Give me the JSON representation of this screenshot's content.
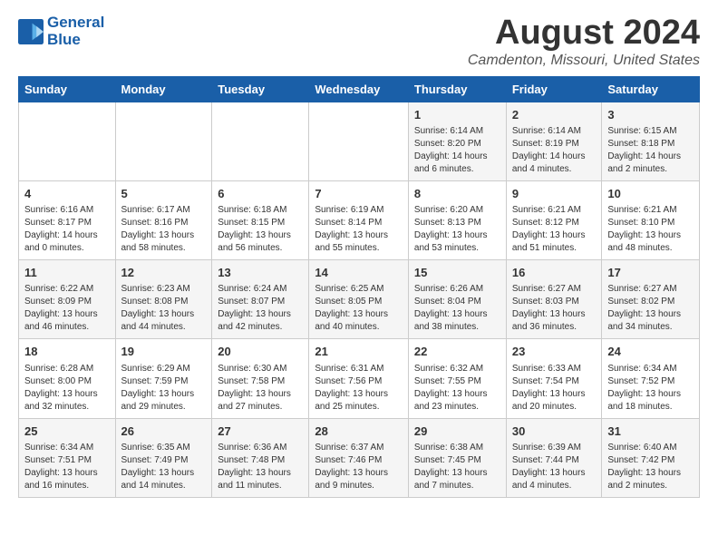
{
  "logo": {
    "line1": "General",
    "line2": "Blue"
  },
  "title": "August 2024",
  "subtitle": "Camdenton, Missouri, United States",
  "days_of_week": [
    "Sunday",
    "Monday",
    "Tuesday",
    "Wednesday",
    "Thursday",
    "Friday",
    "Saturday"
  ],
  "weeks": [
    [
      {
        "num": "",
        "info": ""
      },
      {
        "num": "",
        "info": ""
      },
      {
        "num": "",
        "info": ""
      },
      {
        "num": "",
        "info": ""
      },
      {
        "num": "1",
        "info": "Sunrise: 6:14 AM\nSunset: 8:20 PM\nDaylight: 14 hours\nand 6 minutes."
      },
      {
        "num": "2",
        "info": "Sunrise: 6:14 AM\nSunset: 8:19 PM\nDaylight: 14 hours\nand 4 minutes."
      },
      {
        "num": "3",
        "info": "Sunrise: 6:15 AM\nSunset: 8:18 PM\nDaylight: 14 hours\nand 2 minutes."
      }
    ],
    [
      {
        "num": "4",
        "info": "Sunrise: 6:16 AM\nSunset: 8:17 PM\nDaylight: 14 hours\nand 0 minutes."
      },
      {
        "num": "5",
        "info": "Sunrise: 6:17 AM\nSunset: 8:16 PM\nDaylight: 13 hours\nand 58 minutes."
      },
      {
        "num": "6",
        "info": "Sunrise: 6:18 AM\nSunset: 8:15 PM\nDaylight: 13 hours\nand 56 minutes."
      },
      {
        "num": "7",
        "info": "Sunrise: 6:19 AM\nSunset: 8:14 PM\nDaylight: 13 hours\nand 55 minutes."
      },
      {
        "num": "8",
        "info": "Sunrise: 6:20 AM\nSunset: 8:13 PM\nDaylight: 13 hours\nand 53 minutes."
      },
      {
        "num": "9",
        "info": "Sunrise: 6:21 AM\nSunset: 8:12 PM\nDaylight: 13 hours\nand 51 minutes."
      },
      {
        "num": "10",
        "info": "Sunrise: 6:21 AM\nSunset: 8:10 PM\nDaylight: 13 hours\nand 48 minutes."
      }
    ],
    [
      {
        "num": "11",
        "info": "Sunrise: 6:22 AM\nSunset: 8:09 PM\nDaylight: 13 hours\nand 46 minutes."
      },
      {
        "num": "12",
        "info": "Sunrise: 6:23 AM\nSunset: 8:08 PM\nDaylight: 13 hours\nand 44 minutes."
      },
      {
        "num": "13",
        "info": "Sunrise: 6:24 AM\nSunset: 8:07 PM\nDaylight: 13 hours\nand 42 minutes."
      },
      {
        "num": "14",
        "info": "Sunrise: 6:25 AM\nSunset: 8:05 PM\nDaylight: 13 hours\nand 40 minutes."
      },
      {
        "num": "15",
        "info": "Sunrise: 6:26 AM\nSunset: 8:04 PM\nDaylight: 13 hours\nand 38 minutes."
      },
      {
        "num": "16",
        "info": "Sunrise: 6:27 AM\nSunset: 8:03 PM\nDaylight: 13 hours\nand 36 minutes."
      },
      {
        "num": "17",
        "info": "Sunrise: 6:27 AM\nSunset: 8:02 PM\nDaylight: 13 hours\nand 34 minutes."
      }
    ],
    [
      {
        "num": "18",
        "info": "Sunrise: 6:28 AM\nSunset: 8:00 PM\nDaylight: 13 hours\nand 32 minutes."
      },
      {
        "num": "19",
        "info": "Sunrise: 6:29 AM\nSunset: 7:59 PM\nDaylight: 13 hours\nand 29 minutes."
      },
      {
        "num": "20",
        "info": "Sunrise: 6:30 AM\nSunset: 7:58 PM\nDaylight: 13 hours\nand 27 minutes."
      },
      {
        "num": "21",
        "info": "Sunrise: 6:31 AM\nSunset: 7:56 PM\nDaylight: 13 hours\nand 25 minutes."
      },
      {
        "num": "22",
        "info": "Sunrise: 6:32 AM\nSunset: 7:55 PM\nDaylight: 13 hours\nand 23 minutes."
      },
      {
        "num": "23",
        "info": "Sunrise: 6:33 AM\nSunset: 7:54 PM\nDaylight: 13 hours\nand 20 minutes."
      },
      {
        "num": "24",
        "info": "Sunrise: 6:34 AM\nSunset: 7:52 PM\nDaylight: 13 hours\nand 18 minutes."
      }
    ],
    [
      {
        "num": "25",
        "info": "Sunrise: 6:34 AM\nSunset: 7:51 PM\nDaylight: 13 hours\nand 16 minutes."
      },
      {
        "num": "26",
        "info": "Sunrise: 6:35 AM\nSunset: 7:49 PM\nDaylight: 13 hours\nand 14 minutes."
      },
      {
        "num": "27",
        "info": "Sunrise: 6:36 AM\nSunset: 7:48 PM\nDaylight: 13 hours\nand 11 minutes."
      },
      {
        "num": "28",
        "info": "Sunrise: 6:37 AM\nSunset: 7:46 PM\nDaylight: 13 hours\nand 9 minutes."
      },
      {
        "num": "29",
        "info": "Sunrise: 6:38 AM\nSunset: 7:45 PM\nDaylight: 13 hours\nand 7 minutes."
      },
      {
        "num": "30",
        "info": "Sunrise: 6:39 AM\nSunset: 7:44 PM\nDaylight: 13 hours\nand 4 minutes."
      },
      {
        "num": "31",
        "info": "Sunrise: 6:40 AM\nSunset: 7:42 PM\nDaylight: 13 hours\nand 2 minutes."
      }
    ]
  ]
}
